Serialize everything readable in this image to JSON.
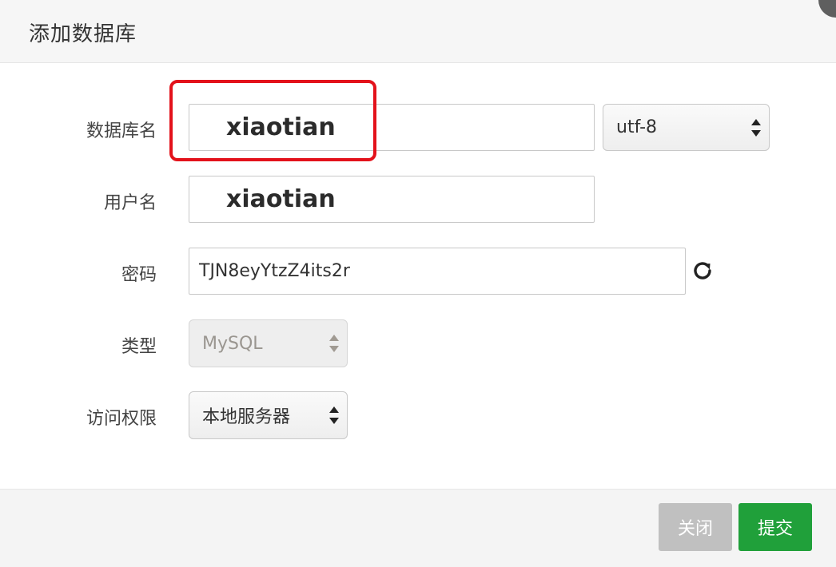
{
  "dialog": {
    "title": "添加数据库"
  },
  "form": {
    "db_name": {
      "label": "数据库名",
      "value": "xiaotian"
    },
    "charset": {
      "selected": "utf-8"
    },
    "username": {
      "label": "用户名",
      "value": "xiaotian"
    },
    "password": {
      "label": "密码",
      "value": "TJN8eyYtzZ4its2r",
      "refresh_icon": "refresh-icon"
    },
    "type": {
      "label": "类型",
      "selected": "MySQL",
      "disabled": true
    },
    "access": {
      "label": "访问权限",
      "selected": "本地服务器"
    }
  },
  "footer": {
    "close_label": "关闭",
    "submit_label": "提交"
  },
  "colors": {
    "highlight": "#e3121b",
    "submit": "#20a03a",
    "close": "#c0c0c0"
  }
}
